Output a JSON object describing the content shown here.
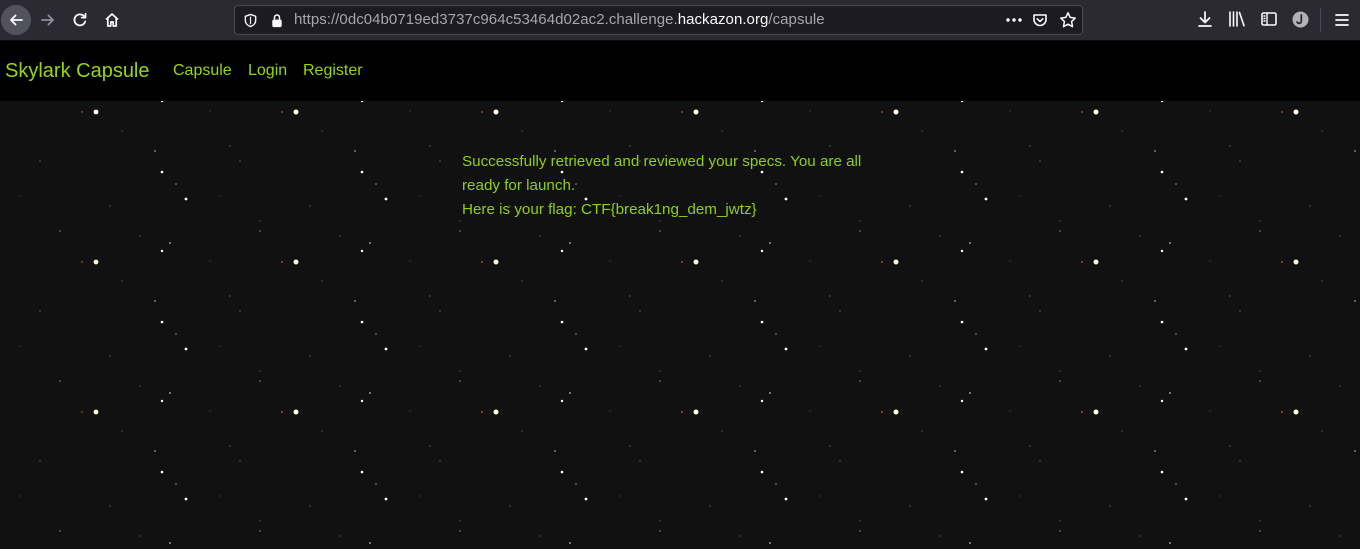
{
  "browser": {
    "url_prefix": "https://0dc04b0719ed3737c964c53464d02ac2.challenge.",
    "url_domain": "hackazon.org",
    "url_path": "/capsule",
    "icons": [
      "back-arrow-icon",
      "forward-arrow-icon",
      "reload-icon",
      "home-icon",
      "shield-icon",
      "lock-icon",
      "more-dots-icon",
      "pocket-icon",
      "star-icon",
      "download-icon",
      "library-icon",
      "sidebar-icon",
      "account-icon",
      "hamburger-menu-icon"
    ]
  },
  "site": {
    "brand": "Skylark Capsule",
    "nav": {
      "capsule": "Capsule",
      "login": "Login",
      "register": "Register"
    },
    "accent_color": "#97d60e"
  },
  "message": {
    "line1": "Successfully retrieved and reviewed your specs. You are all ready for launch.",
    "line2": "Here is your flag: CTF{break1ng_dem_jwtz}"
  }
}
